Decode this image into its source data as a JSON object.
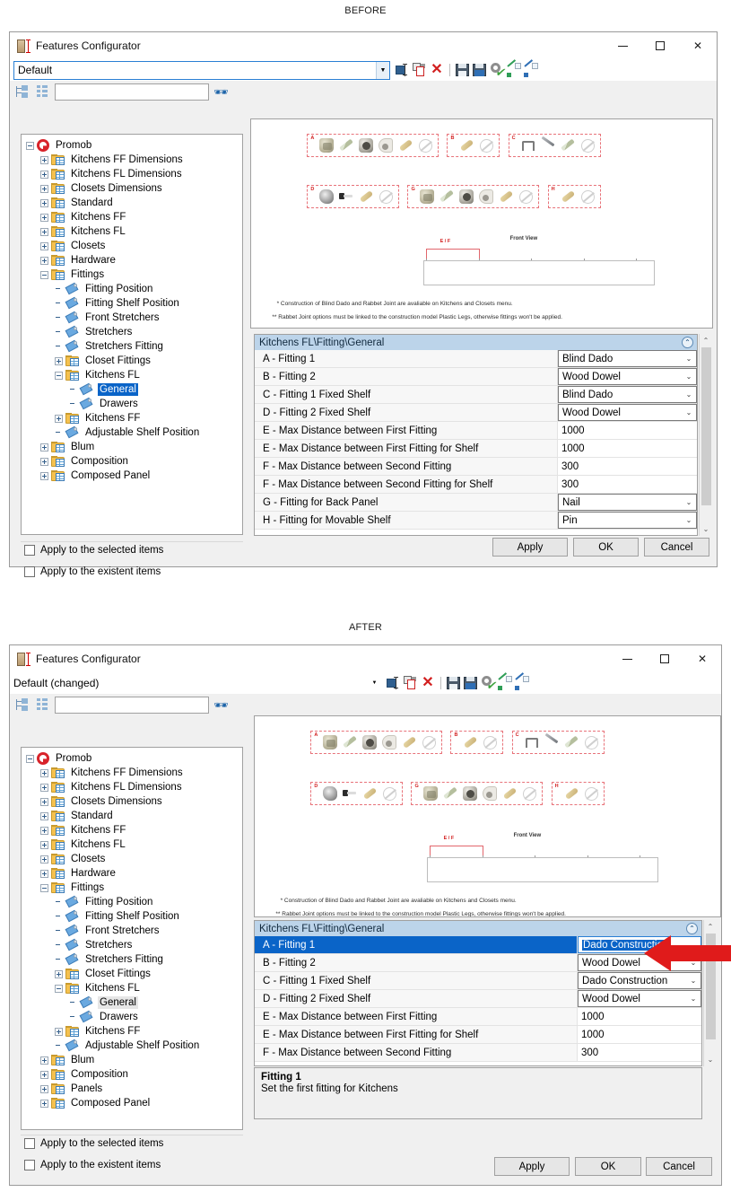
{
  "labels": {
    "before": "BEFORE",
    "after": "AFTER"
  },
  "window": {
    "title": "Features Configurator",
    "icon": "door-measure-icon",
    "minimize": "–",
    "maximize": "□",
    "close": "✕"
  },
  "combo": {
    "before_value": "Default",
    "after_value": "Default (changed)",
    "arrow": "▼"
  },
  "toolbar": {
    "items": [
      {
        "name": "rename-configuration",
        "glyph": "rename-icon"
      },
      {
        "name": "duplicate-delete-configuration",
        "glyph": "copy-delete-icon"
      },
      {
        "name": "delete-configuration",
        "glyph": "red-x-icon"
      },
      {
        "name": "save-configuration",
        "glyph": "save-icon"
      },
      {
        "name": "save-as-configuration",
        "glyph": "save-as-icon"
      },
      {
        "name": "apply-settings",
        "glyph": "gear-check-icon"
      },
      {
        "name": "import-configuration",
        "glyph": "green-arrow-icon"
      },
      {
        "name": "export-configuration",
        "glyph": "blue-arrow-icon"
      }
    ]
  },
  "search": {
    "value": "",
    "placeholder": "",
    "find_icon": "binoculars-icon",
    "collapse_all_icon": "collapse-tree-icon",
    "expand_all_icon": "expand-tree-icon"
  },
  "tree_before": {
    "nodes": [
      {
        "label": "Promob",
        "depth": 0,
        "icon": "promob-logo-icon",
        "exp": "minus",
        "state": "normal"
      },
      {
        "label": "Kitchens FF Dimensions",
        "depth": 1,
        "icon": "folder-grid-icon",
        "exp": "plus",
        "state": "normal"
      },
      {
        "label": "Kitchens FL Dimensions",
        "depth": 1,
        "icon": "folder-grid-icon",
        "exp": "plus",
        "state": "normal"
      },
      {
        "label": "Closets Dimensions",
        "depth": 1,
        "icon": "folder-grid-icon",
        "exp": "plus",
        "state": "normal"
      },
      {
        "label": "Standard",
        "depth": 1,
        "icon": "folder-grid-icon",
        "exp": "plus",
        "state": "normal"
      },
      {
        "label": "Kitchens FF",
        "depth": 1,
        "icon": "folder-grid-icon",
        "exp": "plus",
        "state": "normal"
      },
      {
        "label": "Kitchens FL",
        "depth": 1,
        "icon": "folder-grid-icon",
        "exp": "plus",
        "state": "normal"
      },
      {
        "label": "Closets",
        "depth": 1,
        "icon": "folder-grid-icon",
        "exp": "plus",
        "state": "normal"
      },
      {
        "label": "Hardware",
        "depth": 1,
        "icon": "folder-grid-icon",
        "exp": "plus",
        "state": "normal"
      },
      {
        "label": "Fittings",
        "depth": 1,
        "icon": "folder-grid-icon",
        "exp": "minus",
        "state": "normal"
      },
      {
        "label": "Fitting Position",
        "depth": 2,
        "icon": "tag-icon",
        "exp": "none",
        "state": "normal"
      },
      {
        "label": "Fitting Shelf Position",
        "depth": 2,
        "icon": "tag-icon",
        "exp": "none",
        "state": "normal"
      },
      {
        "label": "Front Stretchers",
        "depth": 2,
        "icon": "tag-icon",
        "exp": "none",
        "state": "normal"
      },
      {
        "label": "Stretchers",
        "depth": 2,
        "icon": "tag-icon",
        "exp": "none",
        "state": "normal"
      },
      {
        "label": "Stretchers Fitting",
        "depth": 2,
        "icon": "tag-icon",
        "exp": "none",
        "state": "normal"
      },
      {
        "label": "Closet Fittings",
        "depth": 2,
        "icon": "folder-grid-icon",
        "exp": "plus",
        "state": "normal"
      },
      {
        "label": "Kitchens FL",
        "depth": 2,
        "icon": "folder-grid-icon",
        "exp": "minus",
        "state": "normal"
      },
      {
        "label": "General",
        "depth": 3,
        "icon": "tag-icon",
        "exp": "none",
        "state": "selected-blue"
      },
      {
        "label": "Drawers",
        "depth": 3,
        "icon": "tag-icon",
        "exp": "none",
        "state": "normal"
      },
      {
        "label": "Kitchens FF",
        "depth": 2,
        "icon": "folder-grid-icon",
        "exp": "plus",
        "state": "normal"
      },
      {
        "label": "Adjustable Shelf Position",
        "depth": 2,
        "icon": "tag-icon",
        "exp": "none",
        "state": "normal"
      },
      {
        "label": "Blum",
        "depth": 1,
        "icon": "folder-grid-icon",
        "exp": "plus",
        "state": "normal"
      },
      {
        "label": "Composition",
        "depth": 1,
        "icon": "folder-grid-icon",
        "exp": "plus",
        "state": "normal"
      },
      {
        "label": "Composed Panel",
        "depth": 1,
        "icon": "folder-grid-icon",
        "exp": "plus",
        "state": "normal"
      }
    ]
  },
  "tree_after": {
    "nodes": [
      {
        "label": "Promob",
        "depth": 0,
        "icon": "promob-logo-icon",
        "exp": "minus",
        "state": "normal"
      },
      {
        "label": "Kitchens FF Dimensions",
        "depth": 1,
        "icon": "folder-grid-icon",
        "exp": "plus",
        "state": "normal"
      },
      {
        "label": "Kitchens FL Dimensions",
        "depth": 1,
        "icon": "folder-grid-icon",
        "exp": "plus",
        "state": "normal"
      },
      {
        "label": "Closets Dimensions",
        "depth": 1,
        "icon": "folder-grid-icon",
        "exp": "plus",
        "state": "normal"
      },
      {
        "label": "Standard",
        "depth": 1,
        "icon": "folder-grid-icon",
        "exp": "plus",
        "state": "normal"
      },
      {
        "label": "Kitchens FF",
        "depth": 1,
        "icon": "folder-grid-icon",
        "exp": "plus",
        "state": "normal"
      },
      {
        "label": "Kitchens FL",
        "depth": 1,
        "icon": "folder-grid-icon",
        "exp": "plus",
        "state": "normal"
      },
      {
        "label": "Closets",
        "depth": 1,
        "icon": "folder-grid-icon",
        "exp": "plus",
        "state": "normal"
      },
      {
        "label": "Hardware",
        "depth": 1,
        "icon": "folder-grid-icon",
        "exp": "plus",
        "state": "normal"
      },
      {
        "label": "Fittings",
        "depth": 1,
        "icon": "folder-grid-icon",
        "exp": "minus",
        "state": "normal"
      },
      {
        "label": "Fitting Position",
        "depth": 2,
        "icon": "tag-icon",
        "exp": "none",
        "state": "normal"
      },
      {
        "label": "Fitting Shelf Position",
        "depth": 2,
        "icon": "tag-icon",
        "exp": "none",
        "state": "normal"
      },
      {
        "label": "Front Stretchers",
        "depth": 2,
        "icon": "tag-icon",
        "exp": "none",
        "state": "normal"
      },
      {
        "label": "Stretchers",
        "depth": 2,
        "icon": "tag-icon",
        "exp": "none",
        "state": "normal"
      },
      {
        "label": "Stretchers Fitting",
        "depth": 2,
        "icon": "tag-icon",
        "exp": "none",
        "state": "normal"
      },
      {
        "label": "Closet Fittings",
        "depth": 2,
        "icon": "folder-grid-icon",
        "exp": "plus",
        "state": "normal"
      },
      {
        "label": "Kitchens FL",
        "depth": 2,
        "icon": "folder-grid-icon",
        "exp": "minus",
        "state": "normal"
      },
      {
        "label": "General",
        "depth": 3,
        "icon": "tag-icon",
        "exp": "none",
        "state": "selected-gray"
      },
      {
        "label": "Drawers",
        "depth": 3,
        "icon": "tag-icon",
        "exp": "none",
        "state": "normal"
      },
      {
        "label": "Kitchens FF",
        "depth": 2,
        "icon": "folder-grid-icon",
        "exp": "plus",
        "state": "normal"
      },
      {
        "label": "Adjustable Shelf Position",
        "depth": 2,
        "icon": "tag-icon",
        "exp": "none",
        "state": "normal"
      },
      {
        "label": "Blum",
        "depth": 1,
        "icon": "folder-grid-icon",
        "exp": "plus",
        "state": "normal"
      },
      {
        "label": "Composition",
        "depth": 1,
        "icon": "folder-grid-icon",
        "exp": "plus",
        "state": "normal"
      },
      {
        "label": "Panels",
        "depth": 1,
        "icon": "folder-grid-icon",
        "exp": "plus",
        "state": "normal"
      },
      {
        "label": "Composed Panel",
        "depth": 1,
        "icon": "folder-grid-icon",
        "exp": "plus",
        "state": "normal"
      }
    ]
  },
  "preview": {
    "groups_row1": [
      {
        "label": "A",
        "parts": [
          "cam-lock",
          "screw",
          "cam-barrel",
          "clip",
          "dowel",
          "none"
        ]
      },
      {
        "label": "B",
        "parts": [
          "dowel",
          "none"
        ]
      },
      {
        "label": "C",
        "parts": [
          "staple",
          "nail",
          "screw",
          "none"
        ]
      }
    ],
    "groups_row2": [
      {
        "label": "D",
        "parts": [
          "minifix",
          "bolt",
          "dowel",
          "none"
        ]
      },
      {
        "label": "G",
        "parts": [
          "cam-lock",
          "screw",
          "cam-barrel",
          "clip",
          "dowel",
          "none"
        ]
      },
      {
        "label": "H",
        "parts": [
          "dowel",
          "none"
        ]
      }
    ],
    "front_view_title": "Front View",
    "dimension_label": "E / F",
    "note1": "*  Construction of Blind Dado and Rabbet Joint are avaliable on Kitchens and Closets menu.",
    "note2": "** Rabbet Joint options must be linked to the construction model Plastic Legs, otherwise fittings won't be applied."
  },
  "propgrid": {
    "header": "Kitchens FL\\Fitting\\General",
    "collapse_icon": "collapse-chevrons-icon",
    "rows_before": [
      {
        "name": "A - Fitting 1",
        "value": "Blind Dado",
        "type": "combo",
        "selected": false
      },
      {
        "name": "B - Fitting 2",
        "value": "Wood Dowel",
        "type": "combo",
        "selected": false
      },
      {
        "name": "C - Fitting 1 Fixed Shelf",
        "value": "Blind Dado",
        "type": "combo",
        "selected": false
      },
      {
        "name": "D - Fitting 2 Fixed Shelf",
        "value": "Wood Dowel",
        "type": "combo",
        "selected": false
      },
      {
        "name": "E - Max Distance between First Fitting",
        "value": "1000",
        "type": "text",
        "selected": false
      },
      {
        "name": "E - Max Distance between First Fitting for Shelf",
        "value": "1000",
        "type": "text",
        "selected": false
      },
      {
        "name": "F - Max Distance between Second Fitting",
        "value": "300",
        "type": "text",
        "selected": false
      },
      {
        "name": "F - Max Distance between Second Fitting for Shelf",
        "value": "300",
        "type": "text",
        "selected": false
      },
      {
        "name": "G - Fitting for Back Panel",
        "value": "Nail",
        "type": "combo",
        "selected": false
      },
      {
        "name": "H - Fitting for Movable Shelf",
        "value": "Pin",
        "type": "combo",
        "selected": false
      }
    ],
    "rows_after": [
      {
        "name": "A - Fitting 1",
        "value": "Dado Construction",
        "type": "editing",
        "selected": true
      },
      {
        "name": "B - Fitting 2",
        "value": "Wood Dowel",
        "type": "combo",
        "selected": false
      },
      {
        "name": "C - Fitting 1 Fixed Shelf",
        "value": "Dado Construction",
        "type": "combo",
        "selected": false
      },
      {
        "name": "D - Fitting 2 Fixed Shelf",
        "value": "Wood Dowel",
        "type": "combo",
        "selected": false
      },
      {
        "name": "E - Max Distance between First Fitting",
        "value": "1000",
        "type": "text",
        "selected": false
      },
      {
        "name": "E - Max Distance between First Fitting for Shelf",
        "value": "1000",
        "type": "text",
        "selected": false
      },
      {
        "name": "F - Max Distance between Second Fitting",
        "value": "300",
        "type": "text",
        "selected": false
      }
    ],
    "scroll_up": "⌃",
    "scroll_down": "⌄"
  },
  "description": {
    "title": "Fitting 1",
    "body": "Set the first fitting for Kitchens"
  },
  "footer": {
    "checkbox_selected": "Apply to the selected items",
    "checkbox_existent": "Apply to the existent items",
    "apply": "Apply",
    "ok": "OK",
    "cancel": "Cancel"
  },
  "annotation": {
    "arrow": "red-left-arrow",
    "color": "#e01b1b"
  }
}
